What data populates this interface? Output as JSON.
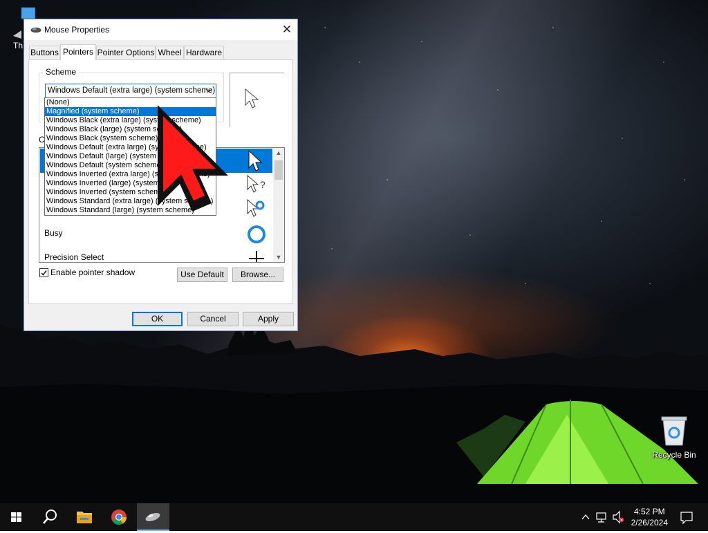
{
  "desktop": {
    "icons": [
      {
        "label": "Th"
      },
      {
        "label": "Recycle Bin"
      }
    ]
  },
  "dialog": {
    "title": "Mouse Properties",
    "close_glyph": "✕",
    "tabs": [
      "Buttons",
      "Pointers",
      "Pointer Options",
      "Wheel",
      "Hardware"
    ],
    "active_tab": "Pointers",
    "scheme": {
      "label": "Scheme",
      "selected": "Windows Default (extra large) (system scheme)",
      "options": [
        "(None)",
        "Magnified (system scheme)",
        "Windows Black (extra large) (system scheme)",
        "Windows Black (large) (system scheme)",
        "Windows Black (system scheme)",
        "Windows Default (extra large) (system scheme)",
        "Windows Default (large) (system scheme)",
        "Windows Default (system scheme)",
        "Windows Inverted (extra large) (system scheme)",
        "Windows Inverted (large) (system scheme)",
        "Windows Inverted (system scheme)",
        "Windows Standard (extra large) (system scheme)",
        "Windows Standard (large) (system scheme)"
      ],
      "highlighted_option": "Magnified (system scheme)"
    },
    "customize": {
      "label": "Cu",
      "rows": [
        {
          "name": "",
          "icon": "normal-select-icon"
        },
        {
          "name": "",
          "icon": "help-select-icon"
        },
        {
          "name": "W",
          "icon": "working-in-background-icon"
        },
        {
          "name": "Busy",
          "icon": "busy-icon"
        },
        {
          "name": "Precision Select",
          "icon": "precision-select-icon"
        }
      ]
    },
    "shadow_checkbox": {
      "label": "Enable pointer shadow",
      "checked": true
    },
    "buttons": {
      "use_default": "Use Default",
      "browse": "Browse...",
      "ok": "OK",
      "cancel": "Cancel",
      "apply": "Apply"
    }
  },
  "taskbar": {
    "items": [
      "start-icon",
      "search-icon",
      "file-explorer-icon",
      "chrome-icon",
      "mouse-properties-icon"
    ],
    "tray": {
      "time": "4:52 PM",
      "date": "2/26/2024",
      "chevron": "^"
    }
  },
  "colors": {
    "accent": "#0078d7",
    "annotation_arrow": "#ff1a1a"
  }
}
